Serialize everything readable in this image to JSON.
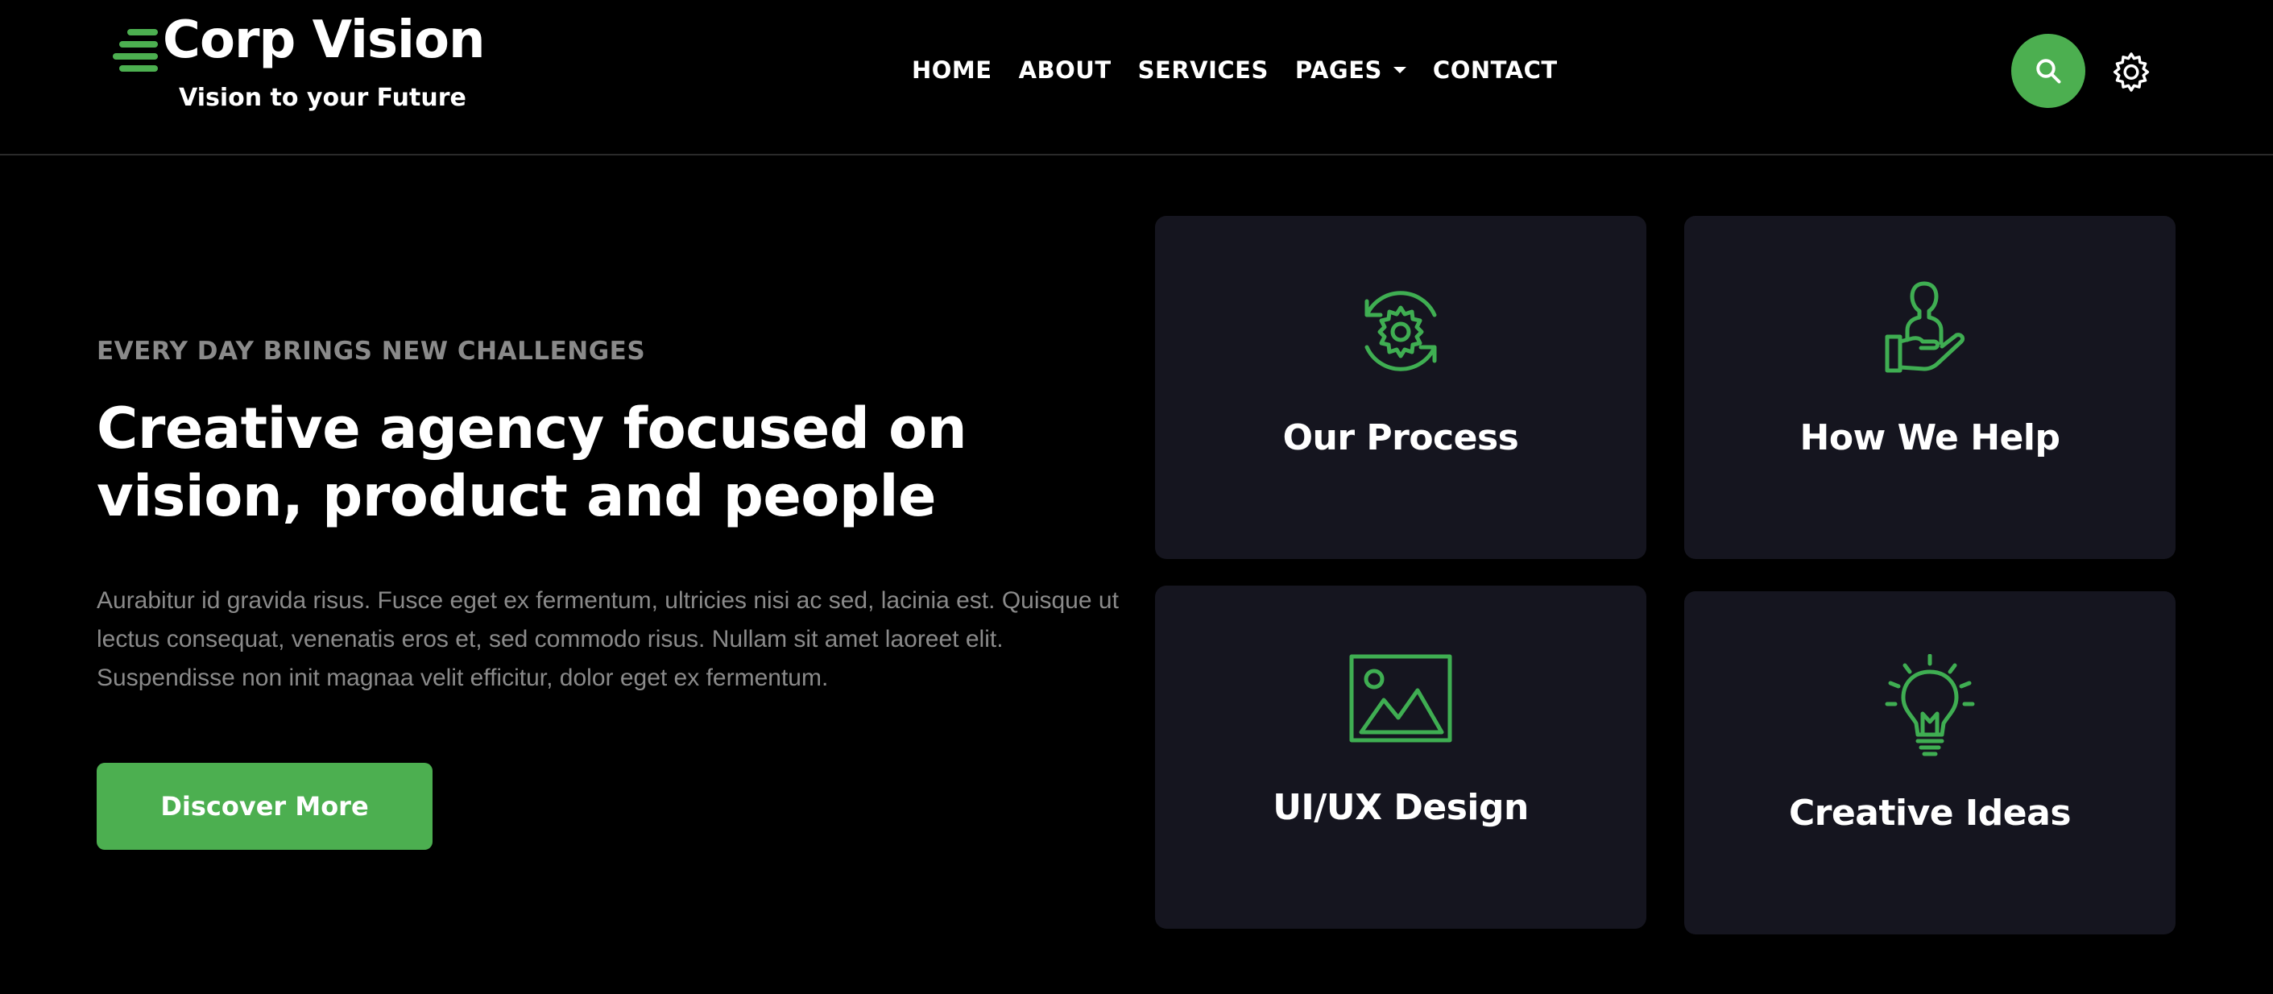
{
  "brand": {
    "title": "Corp Vision",
    "tagline": "Vision to your Future",
    "accent_color": "#4caf50",
    "card_color": "#15151f",
    "logo_icon": "speed-lines-icon"
  },
  "nav": {
    "items": [
      {
        "label": "HOME"
      },
      {
        "label": "ABOUT"
      },
      {
        "label": "SERVICES"
      },
      {
        "label": "PAGES",
        "has_dropdown": true
      },
      {
        "label": "CONTACT"
      }
    ]
  },
  "header_actions": {
    "search_icon": "search-icon",
    "settings_icon": "gear-icon"
  },
  "hero": {
    "eyebrow": "EVERY DAY BRINGS NEW CHALLENGES",
    "headline": "Creative agency focused on vision, product and people",
    "body": "Aurabitur id gravida risus. Fusce eget ex fermentum, ultricies nisi ac sed, lacinia est. Quisque ut lectus consequat, venenatis eros et, sed commodo risus. Nullam sit amet laoreet elit. Suspendisse non init magnaa velit efficitur, dolor eget ex fermentum.",
    "cta_label": "Discover More"
  },
  "features": [
    {
      "title": "Our Process",
      "icon": "gear-refresh-icon"
    },
    {
      "title": "How We Help",
      "icon": "hand-person-icon"
    },
    {
      "title": "UI/UX Design",
      "icon": "image-icon"
    },
    {
      "title": "Creative Ideas",
      "icon": "lightbulb-icon"
    }
  ]
}
